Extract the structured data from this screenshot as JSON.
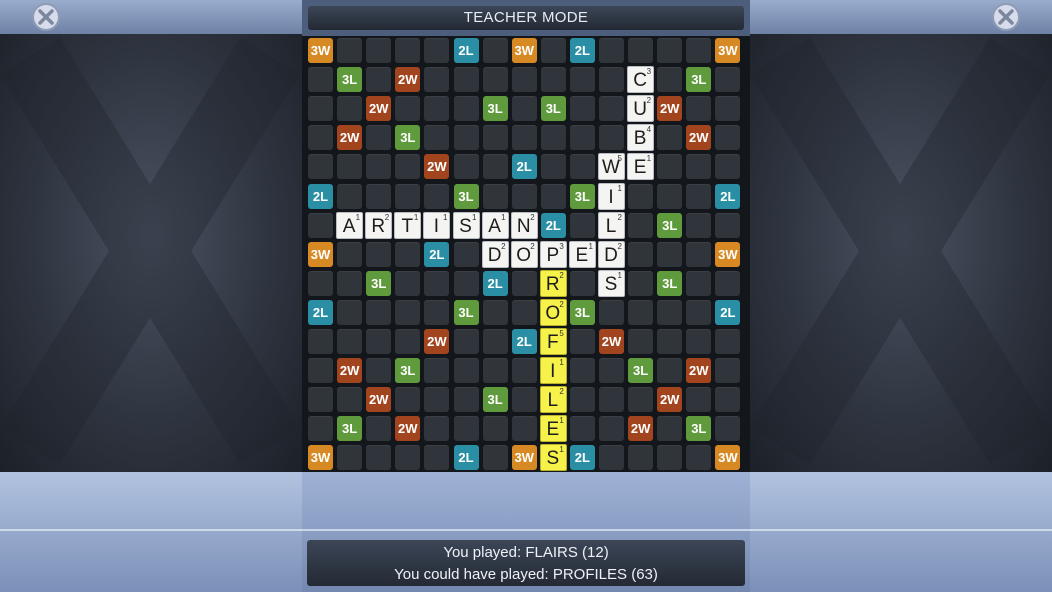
{
  "header": {
    "title": "TEACHER MODE"
  },
  "footer": {
    "played_line": "You played: FLAIRS (12)",
    "best_line": "You could have played: PROFILES (63)"
  },
  "colors": {
    "3W": "#d78a24",
    "2W": "#a2451e",
    "3L": "#5f9a3c",
    "2L": "#2a8fa4",
    "highlight": "#f6f24a"
  },
  "board": {
    "size": 15,
    "bonus": [
      {
        "row": 0,
        "col": 0,
        "label": "3W"
      },
      {
        "row": 0,
        "col": 5,
        "label": "2L"
      },
      {
        "row": 0,
        "col": 7,
        "label": "3W"
      },
      {
        "row": 0,
        "col": 9,
        "label": "2L"
      },
      {
        "row": 0,
        "col": 14,
        "label": "3W"
      },
      {
        "row": 1,
        "col": 1,
        "label": "3L"
      },
      {
        "row": 1,
        "col": 3,
        "label": "2W"
      },
      {
        "row": 1,
        "col": 13,
        "label": "3L"
      },
      {
        "row": 2,
        "col": 2,
        "label": "2W"
      },
      {
        "row": 2,
        "col": 6,
        "label": "3L"
      },
      {
        "row": 2,
        "col": 8,
        "label": "3L"
      },
      {
        "row": 2,
        "col": 12,
        "label": "2W"
      },
      {
        "row": 3,
        "col": 1,
        "label": "2W"
      },
      {
        "row": 3,
        "col": 3,
        "label": "3L"
      },
      {
        "row": 3,
        "col": 13,
        "label": "2W"
      },
      {
        "row": 4,
        "col": 4,
        "label": "2W"
      },
      {
        "row": 4,
        "col": 7,
        "label": "2L"
      },
      {
        "row": 5,
        "col": 0,
        "label": "2L"
      },
      {
        "row": 5,
        "col": 5,
        "label": "3L"
      },
      {
        "row": 5,
        "col": 9,
        "label": "3L"
      },
      {
        "row": 5,
        "col": 14,
        "label": "2L"
      },
      {
        "row": 6,
        "col": 8,
        "label": "2L"
      },
      {
        "row": 6,
        "col": 12,
        "label": "3L"
      },
      {
        "row": 7,
        "col": 0,
        "label": "3W"
      },
      {
        "row": 7,
        "col": 4,
        "label": "2L"
      },
      {
        "row": 7,
        "col": 14,
        "label": "3W"
      },
      {
        "row": 8,
        "col": 2,
        "label": "3L"
      },
      {
        "row": 8,
        "col": 6,
        "label": "2L"
      },
      {
        "row": 8,
        "col": 12,
        "label": "3L"
      },
      {
        "row": 9,
        "col": 0,
        "label": "2L"
      },
      {
        "row": 9,
        "col": 5,
        "label": "3L"
      },
      {
        "row": 9,
        "col": 9,
        "label": "3L"
      },
      {
        "row": 9,
        "col": 14,
        "label": "2L"
      },
      {
        "row": 10,
        "col": 4,
        "label": "2W"
      },
      {
        "row": 10,
        "col": 7,
        "label": "2L"
      },
      {
        "row": 10,
        "col": 10,
        "label": "2W"
      },
      {
        "row": 11,
        "col": 1,
        "label": "2W"
      },
      {
        "row": 11,
        "col": 3,
        "label": "3L"
      },
      {
        "row": 11,
        "col": 11,
        "label": "3L"
      },
      {
        "row": 11,
        "col": 13,
        "label": "2W"
      },
      {
        "row": 12,
        "col": 2,
        "label": "2W"
      },
      {
        "row": 12,
        "col": 6,
        "label": "3L"
      },
      {
        "row": 12,
        "col": 12,
        "label": "2W"
      },
      {
        "row": 13,
        "col": 1,
        "label": "3L"
      },
      {
        "row": 13,
        "col": 3,
        "label": "2W"
      },
      {
        "row": 13,
        "col": 11,
        "label": "2W"
      },
      {
        "row": 13,
        "col": 13,
        "label": "3L"
      },
      {
        "row": 14,
        "col": 0,
        "label": "3W"
      },
      {
        "row": 14,
        "col": 5,
        "label": "2L"
      },
      {
        "row": 14,
        "col": 7,
        "label": "3W"
      },
      {
        "row": 14,
        "col": 9,
        "label": "2L"
      },
      {
        "row": 14,
        "col": 14,
        "label": "3W"
      }
    ],
    "tiles": [
      {
        "row": 1,
        "col": 11,
        "letter": "C",
        "points": "3",
        "highlight": false
      },
      {
        "row": 2,
        "col": 11,
        "letter": "U",
        "points": "2",
        "highlight": false
      },
      {
        "row": 3,
        "col": 11,
        "letter": "B",
        "points": "4",
        "highlight": false
      },
      {
        "row": 4,
        "col": 10,
        "letter": "W",
        "points": "5",
        "highlight": false
      },
      {
        "row": 4,
        "col": 11,
        "letter": "E",
        "points": "1",
        "highlight": false
      },
      {
        "row": 5,
        "col": 10,
        "letter": "I",
        "points": "1",
        "highlight": false
      },
      {
        "row": 6,
        "col": 1,
        "letter": "A",
        "points": "1",
        "highlight": false
      },
      {
        "row": 6,
        "col": 2,
        "letter": "R",
        "points": "2",
        "highlight": false
      },
      {
        "row": 6,
        "col": 3,
        "letter": "T",
        "points": "1",
        "highlight": false
      },
      {
        "row": 6,
        "col": 4,
        "letter": "I",
        "points": "1",
        "highlight": false
      },
      {
        "row": 6,
        "col": 5,
        "letter": "S",
        "points": "1",
        "highlight": false
      },
      {
        "row": 6,
        "col": 6,
        "letter": "A",
        "points": "1",
        "highlight": false
      },
      {
        "row": 6,
        "col": 7,
        "letter": "N",
        "points": "2",
        "highlight": false
      },
      {
        "row": 6,
        "col": 10,
        "letter": "L",
        "points": "2",
        "highlight": false
      },
      {
        "row": 7,
        "col": 6,
        "letter": "D",
        "points": "2",
        "highlight": false
      },
      {
        "row": 7,
        "col": 7,
        "letter": "O",
        "points": "2",
        "highlight": false
      },
      {
        "row": 7,
        "col": 8,
        "letter": "P",
        "points": "3",
        "highlight": false
      },
      {
        "row": 7,
        "col": 9,
        "letter": "E",
        "points": "1",
        "highlight": false
      },
      {
        "row": 7,
        "col": 10,
        "letter": "D",
        "points": "2",
        "highlight": false
      },
      {
        "row": 8,
        "col": 8,
        "letter": "R",
        "points": "2",
        "highlight": true
      },
      {
        "row": 8,
        "col": 10,
        "letter": "S",
        "points": "1",
        "highlight": false
      },
      {
        "row": 9,
        "col": 8,
        "letter": "O",
        "points": "2",
        "highlight": true
      },
      {
        "row": 10,
        "col": 8,
        "letter": "F",
        "points": "5",
        "highlight": true
      },
      {
        "row": 11,
        "col": 8,
        "letter": "I",
        "points": "1",
        "highlight": true
      },
      {
        "row": 12,
        "col": 8,
        "letter": "L",
        "points": "2",
        "highlight": true
      },
      {
        "row": 13,
        "col": 8,
        "letter": "E",
        "points": "1",
        "highlight": true
      },
      {
        "row": 14,
        "col": 8,
        "letter": "S",
        "points": "1",
        "highlight": true
      }
    ]
  }
}
